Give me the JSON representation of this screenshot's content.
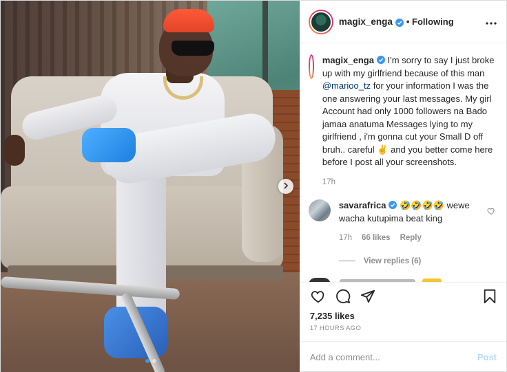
{
  "post": {
    "author": "magix_enga",
    "follow_state": "• Following",
    "more_icon": "more-horizontal-icon",
    "accent": "#3897f0"
  },
  "caption": {
    "username": "magix_enga",
    "text_before_mention": "I'm sorry to say I just broke up with my girlfriend because of this man ",
    "mention": "@marioo_tz",
    "text_after_mention": " for your information I was the one answering your last messages. My girl Account had only 1000 followers na Bado jamaa anatuma Messages lying to my girlfriend , i'm gonna cut your Small D off bruh.. careful ✌️ and you better come here before I post all your screenshots.",
    "time": "17h"
  },
  "comments": [
    {
      "username": "savarafrica",
      "text": "🤣🤣🤣🤣 wewe wacha kutupima beat king",
      "time": "17h",
      "likes": "66 likes",
      "reply_label": "Reply",
      "view_replies": "View replies (6)"
    }
  ],
  "stats": {
    "likes": "7,235 likes",
    "time_ago": "17 HOURS AGO"
  },
  "composer": {
    "placeholder": "Add a comment...",
    "post_label": "Post"
  },
  "carousel": {
    "total": 2,
    "current": 1
  }
}
